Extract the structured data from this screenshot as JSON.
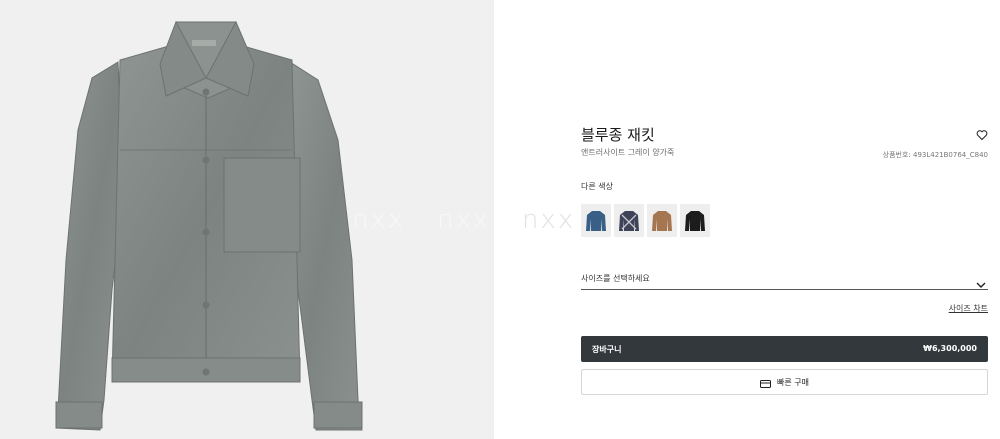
{
  "product": {
    "name": "블루종 재킷",
    "subtitle": "앤트러사이트 그레이 양가죽",
    "reference": "상품번호: 493L421B0764_C840"
  },
  "watermark": "nxx",
  "colors": {
    "label": "다른 색상",
    "options": [
      {
        "icon": "navy-denim-jacket-thumbnail",
        "color": "#3a5f86"
      },
      {
        "icon": "checked-jacket-thumbnail",
        "color": "#3e4358"
      },
      {
        "icon": "tan-suede-jacket-thumbnail",
        "color": "#a67650"
      },
      {
        "icon": "black-leather-jacket-thumbnail",
        "color": "#1c1c1c"
      }
    ]
  },
  "size": {
    "placeholder": "사이즈를 선택하세요",
    "chart_link": "사이즈 차트"
  },
  "actions": {
    "cart_label": "장바구니",
    "price": "₩6,300,000",
    "buy_label": "빠른 구매"
  },
  "theme": {
    "accent": "#33383c",
    "jacket": "#8a908d"
  }
}
